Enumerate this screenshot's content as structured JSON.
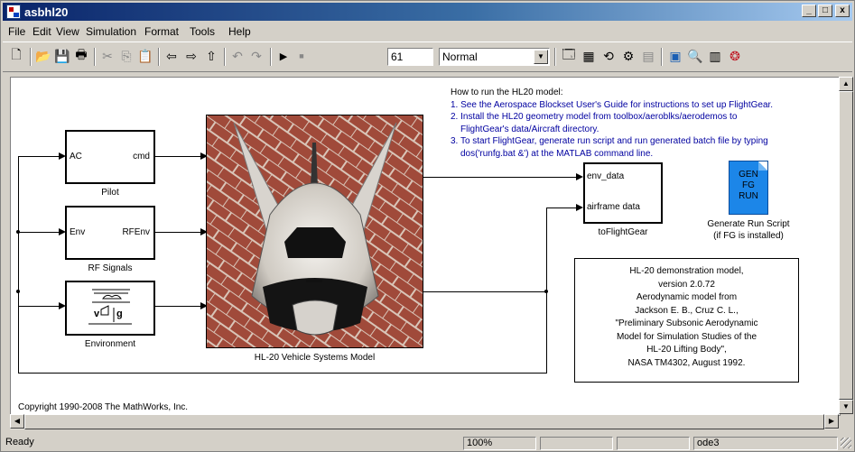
{
  "window": {
    "title": "asbhl20",
    "min": "_",
    "max": "□",
    "close": "x"
  },
  "menu": [
    "File",
    "Edit",
    "View",
    "Simulation",
    "Format",
    "Tools",
    "Help"
  ],
  "toolbar": {
    "stop_time": "61",
    "sim_mode": "Normal",
    "icons": [
      "new-icon",
      "open-icon",
      "save-icon",
      "print-icon",
      "cut-icon",
      "copy-icon",
      "paste-icon",
      "back-icon",
      "forward-icon",
      "up-icon",
      "undo-icon",
      "redo-icon",
      "play-icon",
      "stop-icon",
      "library-icon",
      "model-explorer-icon",
      "debug-icon",
      "update-icon",
      "build-icon",
      "config-icon",
      "explorer-icon",
      "properties-icon",
      "record-icon"
    ]
  },
  "instructions": {
    "heading": "How to run the HL20 model:",
    "lines": [
      "1. See the Aerospace Blockset User's Guide for instructions to set up FlightGear.",
      "2. Install the HL20 geometry model from toolbox/aeroblks/aerodemos to",
      "FlightGear's data/Aircraft directory.",
      "3. To start FlightGear, generate run script and run generated batch file by typing",
      "dos('runfg.bat &') at the MATLAB command line."
    ]
  },
  "blocks": {
    "pilot": {
      "in": "AC",
      "out": "cmd",
      "label": "Pilot"
    },
    "rf": {
      "in": "Env",
      "out": "RFEnv",
      "label": "RF Signals"
    },
    "env": {
      "label": "Environment",
      "icon": "environment-icon"
    },
    "vehicle": {
      "label": "HL-20 Vehicle Systems Model",
      "image": "hl20-vehicle-photo"
    },
    "fg": {
      "in1": "env_data",
      "in2": "airframe data",
      "label": "toFlightGear"
    },
    "gen": {
      "icon_text": [
        "GEN",
        "FG",
        "RUN"
      ],
      "label1": "Generate Run Script",
      "label2": "(if FG is installed)"
    }
  },
  "info": [
    "HL-20 demonstration model,",
    "version 2.0.72",
    "Aerodynamic model from",
    "Jackson E. B., Cruz C. L.,",
    "\"Preliminary Subsonic Aerodynamic",
    "Model for Simulation Studies of the",
    "HL-20 Lifting Body\",",
    "NASA TM4302, August 1992."
  ],
  "copyright": "Copyright 1990-2008 The MathWorks, Inc.",
  "status": {
    "left": "Ready",
    "zoom": "100%",
    "solver": "ode3"
  }
}
